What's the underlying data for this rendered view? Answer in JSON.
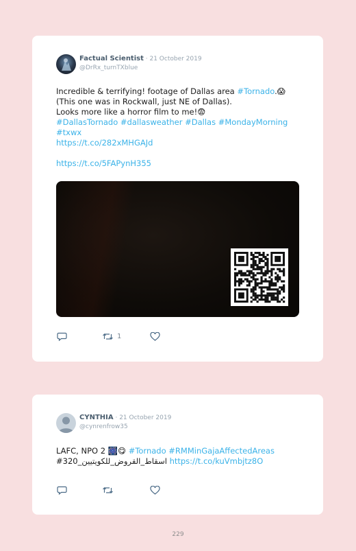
{
  "tweets": [
    {
      "author": "Factual Scientist",
      "separator": " · ",
      "date": "21 October 2019",
      "handle": "@DrRx_turnTXblue",
      "line1_pre": "Incredible & terrifying! footage of Dallas area ",
      "line1_tag": "#Tornado",
      "line1_post": ".😱",
      "line2": "(This one was in Rockwall, just NE of Dallas).",
      "line3": "Looks more like a horror film to me!😨",
      "hashtags": "#DallasTornado #dallasweather #Dallas #MondayMorning",
      "hashtags2": "#txwx",
      "link1": "https://t.co/282xMHGAJd",
      "link2": "https://t.co/5FAPynH355",
      "retweet_count": "1",
      "reply_icon": "reply-icon",
      "retweet_icon": "retweet-icon",
      "like_icon": "heart-icon"
    },
    {
      "author": "CYNTHIA",
      "separator": " · ",
      "date": "21 October 2019",
      "handle": "@cynrenfrow35",
      "line1_pre": "LAFC, NPO 2 🎆😋 ",
      "line1_tags": "#Tornado #RMMinGajaAffectedAreas",
      "line2_pre": "#اسقاط_القروض_للكويتيين_320 ",
      "line2_link": "https://t.co/kuVmbjtz8O",
      "reply_icon": "reply-icon",
      "retweet_icon": "retweet-icon",
      "like_icon": "heart-icon"
    }
  ],
  "page_number": "229",
  "colors": {
    "background": "#f8dfe0",
    "card": "#ffffff",
    "link": "#3ab2e8",
    "name": "#4a5d6e",
    "meta": "#97a4b0"
  }
}
